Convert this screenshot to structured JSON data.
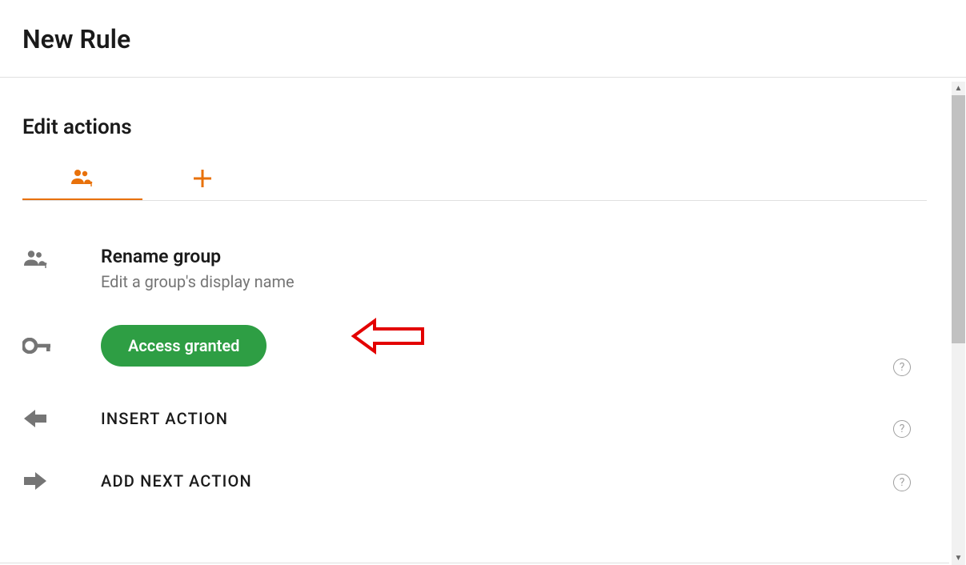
{
  "page": {
    "title": "New Rule",
    "section_title": "Edit actions"
  },
  "tabs": {
    "group_icon": "group-info-icon",
    "add_icon": "plus-icon"
  },
  "rows": {
    "rename": {
      "title": "Rename group",
      "subtitle": "Edit a group's display name"
    },
    "access": {
      "badge": "Access granted"
    },
    "insert": {
      "label": "INSERT ACTION"
    },
    "addnext": {
      "label": "ADD NEXT ACTION"
    }
  },
  "colors": {
    "accent": "#e8710a",
    "success": "#2e9e44",
    "text": "#1a1a1a",
    "muted": "#757575",
    "annotation": "#e30000"
  }
}
